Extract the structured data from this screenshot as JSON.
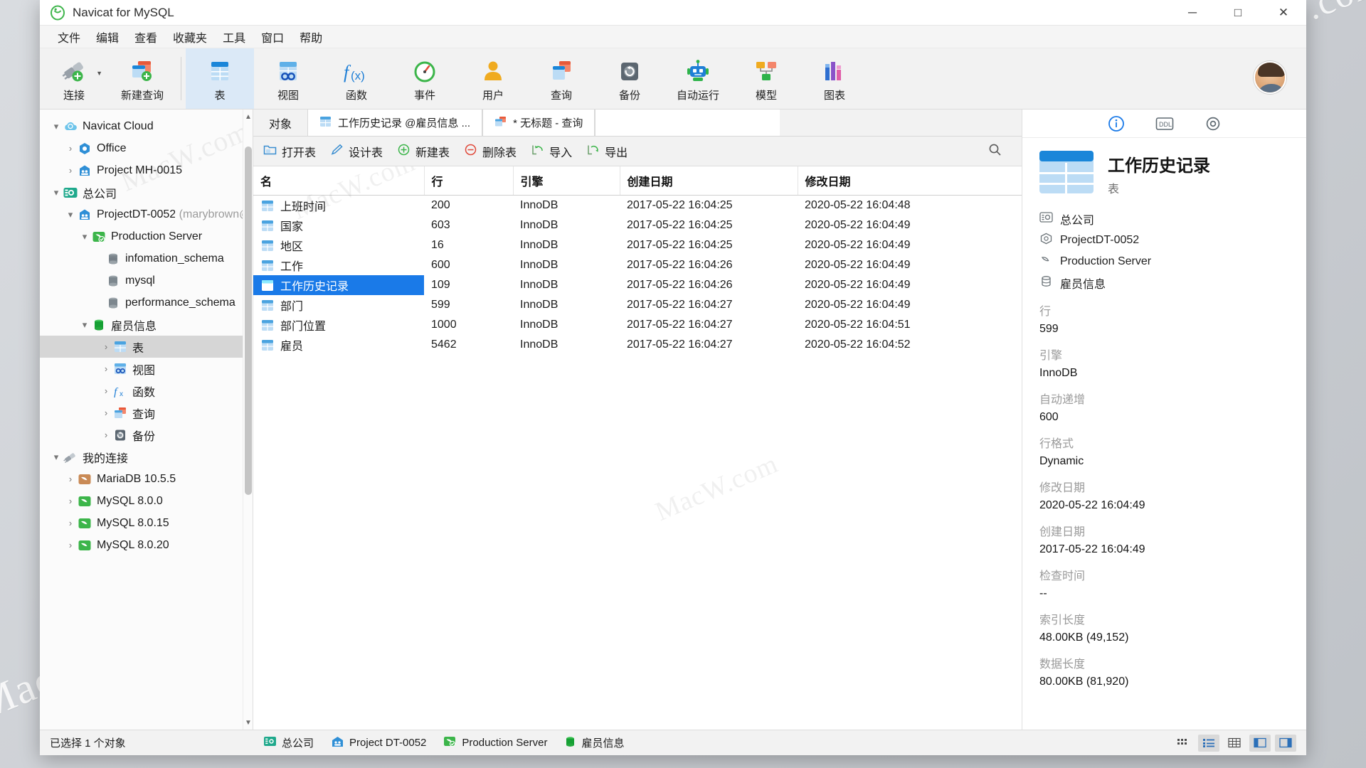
{
  "window": {
    "title": "Navicat for MySQL",
    "minimize": "─",
    "maximize": "□",
    "close": "✕"
  },
  "menubar": {
    "items": [
      {
        "label": "文件",
        "name": "menu-file"
      },
      {
        "label": "编辑",
        "name": "menu-edit"
      },
      {
        "label": "查看",
        "name": "menu-view"
      },
      {
        "label": "收藏夹",
        "name": "menu-favorites"
      },
      {
        "label": "工具",
        "name": "menu-tools"
      },
      {
        "label": "窗口",
        "name": "menu-window"
      },
      {
        "label": "帮助",
        "name": "menu-help"
      }
    ]
  },
  "toolbar": {
    "items": [
      {
        "label": "连接",
        "icon": "connection-icon",
        "active": false
      },
      {
        "label": "新建查询",
        "icon": "new-query-icon",
        "active": false
      },
      {
        "label": "表",
        "icon": "table-icon",
        "active": true
      },
      {
        "label": "视图",
        "icon": "view-icon",
        "active": false
      },
      {
        "label": "函数",
        "icon": "function-icon",
        "active": false
      },
      {
        "label": "事件",
        "icon": "event-icon",
        "active": false
      },
      {
        "label": "用户",
        "icon": "user-icon",
        "active": false
      },
      {
        "label": "查询",
        "icon": "query-icon",
        "active": false
      },
      {
        "label": "备份",
        "icon": "backup-icon",
        "active": false
      },
      {
        "label": "自动运行",
        "icon": "automation-icon",
        "active": false
      },
      {
        "label": "模型",
        "icon": "model-icon",
        "active": false
      },
      {
        "label": "图表",
        "icon": "chart-icon",
        "active": false
      }
    ]
  },
  "sidebar": {
    "nodes": [
      {
        "label": "Navicat Cloud",
        "suffix": "",
        "depth": 0,
        "twisty": "down",
        "icon": "cloud-icon",
        "selected": false
      },
      {
        "label": "Office",
        "suffix": "",
        "depth": 1,
        "twisty": "right",
        "icon": "project-office-icon",
        "selected": false
      },
      {
        "label": "Project MH-0015",
        "suffix": "",
        "depth": 1,
        "twisty": "right",
        "icon": "project-icon",
        "selected": false
      },
      {
        "label": "总公司",
        "suffix": "",
        "depth": 0,
        "twisty": "down",
        "icon": "company-icon",
        "selected": false
      },
      {
        "label": "ProjectDT-0052",
        "suffix": "(marybrown@",
        "depth": 1,
        "twisty": "down",
        "icon": "project-icon",
        "selected": false
      },
      {
        "label": "Production Server",
        "suffix": "",
        "depth": 2,
        "twisty": "down",
        "icon": "server-icon",
        "selected": false
      },
      {
        "label": "infomation_schema",
        "suffix": "",
        "depth": 3,
        "twisty": "none",
        "icon": "db-gray-icon",
        "selected": false
      },
      {
        "label": "mysql",
        "suffix": "",
        "depth": 3,
        "twisty": "none",
        "icon": "db-gray-icon",
        "selected": false
      },
      {
        "label": "performance_schema",
        "suffix": "",
        "depth": 3,
        "twisty": "none",
        "icon": "db-gray-icon",
        "selected": false
      },
      {
        "label": "雇员信息",
        "suffix": "",
        "depth": 3,
        "twisty": "down",
        "icon": "db-green-icon",
        "selected": false
      },
      {
        "label": "表",
        "suffix": "",
        "depth": 4,
        "twisty": "right",
        "icon": "table-icon",
        "selected": true
      },
      {
        "label": "视图",
        "suffix": "",
        "depth": 4,
        "twisty": "right",
        "icon": "view-icon",
        "selected": false
      },
      {
        "label": "函数",
        "suffix": "",
        "depth": 4,
        "twisty": "right",
        "icon": "function-icon",
        "selected": false
      },
      {
        "label": "查询",
        "suffix": "",
        "depth": 4,
        "twisty": "right",
        "icon": "query-icon",
        "selected": false
      },
      {
        "label": "备份",
        "suffix": "",
        "depth": 4,
        "twisty": "right",
        "icon": "backup-icon",
        "selected": false
      },
      {
        "label": "我的连接",
        "suffix": "",
        "depth": 0,
        "twisty": "down",
        "icon": "myconn-icon",
        "selected": false
      },
      {
        "label": "MariaDB 10.5.5",
        "suffix": "",
        "depth": 1,
        "twisty": "right",
        "icon": "mariadb-icon",
        "selected": false
      },
      {
        "label": "MySQL 8.0.0",
        "suffix": "",
        "depth": 1,
        "twisty": "right",
        "icon": "mysql-icon",
        "selected": false
      },
      {
        "label": "MySQL 8.0.15",
        "suffix": "",
        "depth": 1,
        "twisty": "right",
        "icon": "mysql-icon",
        "selected": false
      },
      {
        "label": "MySQL 8.0.20",
        "suffix": "",
        "depth": 1,
        "twisty": "right",
        "icon": "mysql-icon",
        "selected": false
      }
    ]
  },
  "center": {
    "object_label": "对象",
    "tabs": [
      {
        "label": "工作历史记录 @雇员信息 ...",
        "icon": "table-icon",
        "active": true
      },
      {
        "label": "* 无标题 - 查询",
        "icon": "query-icon",
        "active": false
      }
    ],
    "actions": [
      {
        "label": "打开表",
        "icon": "open-table-icon"
      },
      {
        "label": "设计表",
        "icon": "design-table-icon"
      },
      {
        "label": "新建表",
        "icon": "new-table-icon"
      },
      {
        "label": "删除表",
        "icon": "delete-table-icon"
      },
      {
        "label": "导入",
        "icon": "import-icon"
      },
      {
        "label": "导出",
        "icon": "export-icon"
      }
    ],
    "search_icon": "search-icon",
    "table": {
      "columns": [
        "名",
        "行",
        "引擎",
        "创建日期",
        "修改日期"
      ],
      "rows": [
        {
          "name": "上班时间",
          "rows": "200",
          "engine": "InnoDB",
          "created": "2017-05-22 16:04:25",
          "modified": "2020-05-22 16:04:48",
          "selected": false
        },
        {
          "name": "国家",
          "rows": "603",
          "engine": "InnoDB",
          "created": "2017-05-22 16:04:25",
          "modified": "2020-05-22 16:04:49",
          "selected": false
        },
        {
          "name": "地区",
          "rows": "16",
          "engine": "InnoDB",
          "created": "2017-05-22 16:04:25",
          "modified": "2020-05-22 16:04:49",
          "selected": false
        },
        {
          "name": "工作",
          "rows": "600",
          "engine": "InnoDB",
          "created": "2017-05-22 16:04:26",
          "modified": "2020-05-22 16:04:49",
          "selected": false
        },
        {
          "name": "工作历史记录",
          "rows": "109",
          "engine": "InnoDB",
          "created": "2017-05-22 16:04:26",
          "modified": "2020-05-22 16:04:49",
          "selected": true
        },
        {
          "name": "部门",
          "rows": "599",
          "engine": "InnoDB",
          "created": "2017-05-22 16:04:27",
          "modified": "2020-05-22 16:04:49",
          "selected": false
        },
        {
          "name": "部门位置",
          "rows": "1000",
          "engine": "InnoDB",
          "created": "2017-05-22 16:04:27",
          "modified": "2020-05-22 16:04:51",
          "selected": false
        },
        {
          "name": "雇员",
          "rows": "5462",
          "engine": "InnoDB",
          "created": "2017-05-22 16:04:27",
          "modified": "2020-05-22 16:04:52",
          "selected": false
        }
      ]
    }
  },
  "info": {
    "tabs": [
      {
        "name": "info-tab-general",
        "icon": "info-circle-icon",
        "active": true
      },
      {
        "name": "info-tab-ddl",
        "icon": "ddl-icon",
        "active": false
      },
      {
        "name": "info-tab-settings",
        "icon": "gear-icon",
        "active": false
      }
    ],
    "title": "工作历史记录",
    "subtitle": "表",
    "breadcrumbs": [
      {
        "label": "总公司",
        "icon": "company-icon"
      },
      {
        "label": "ProjectDT-0052",
        "icon": "project-hex-icon"
      },
      {
        "label": "Production Server",
        "icon": "server-outline-icon"
      },
      {
        "label": "雇员信息",
        "icon": "db-outline-icon"
      }
    ],
    "properties": [
      {
        "key": "行",
        "value": "599"
      },
      {
        "key": "引擎",
        "value": "InnoDB"
      },
      {
        "key": "自动递增",
        "value": "600"
      },
      {
        "key": "行格式",
        "value": "Dynamic"
      },
      {
        "key": "修改日期",
        "value": "2020-05-22 16:04:49"
      },
      {
        "key": "创建日期",
        "value": "2017-05-22 16:04:49"
      },
      {
        "key": "检查时间",
        "value": "--"
      },
      {
        "key": "索引长度",
        "value": "48.00KB (49,152)"
      },
      {
        "key": "数据长度",
        "value": "80.00KB (81,920)"
      }
    ]
  },
  "status": {
    "left": "已选择 1 个对象",
    "items": [
      {
        "label": "总公司",
        "icon": "company-icon"
      },
      {
        "label": "Project DT-0052",
        "icon": "project-icon"
      },
      {
        "label": "Production Server",
        "icon": "server-icon"
      },
      {
        "label": "雇员信息",
        "icon": "db-green-icon"
      }
    ],
    "view_buttons": [
      {
        "name": "view-grid-icon",
        "active": false
      },
      {
        "name": "view-list-icon",
        "active": true
      },
      {
        "name": "view-detail-icon",
        "active": false
      },
      {
        "name": "panel-left-icon",
        "active": true
      },
      {
        "name": "panel-right-icon",
        "active": true
      }
    ]
  },
  "watermarks": {
    "text": "MacW.com",
    "text2": "MacW.com"
  },
  "colors": {
    "accent": "#1a7ae8",
    "toolbar_active": "#dbe9f7",
    "green": "#2eb34a",
    "orange": "#e8663c"
  }
}
